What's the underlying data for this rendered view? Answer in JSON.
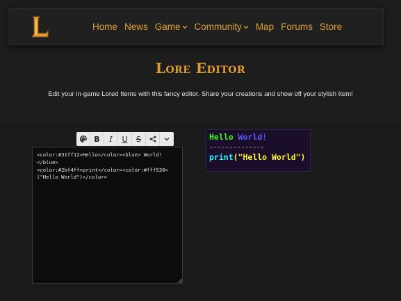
{
  "nav": {
    "items": [
      {
        "label": "Home"
      },
      {
        "label": "News"
      },
      {
        "label": "Game"
      },
      {
        "label": "Community"
      },
      {
        "label": "Map"
      },
      {
        "label": "Forums"
      },
      {
        "label": "Store"
      }
    ],
    "logo_letter": "L"
  },
  "hero": {
    "title": "Lore Editor",
    "subtitle": "Edit your in-game Lored Items with this fancy editor. Share your creations and show off your stylish Item!"
  },
  "toolbar": {
    "buttons": [
      {
        "icon": "palette-icon",
        "glyph": "🎨"
      },
      {
        "icon": "bold-icon",
        "glyph": "B"
      },
      {
        "icon": "italic-icon",
        "glyph": "I"
      },
      {
        "icon": "underline-icon",
        "glyph": "U"
      },
      {
        "icon": "strikethrough-icon",
        "glyph": "S"
      },
      {
        "icon": "share-icon",
        "glyph": "⟨"
      },
      {
        "icon": "chevron-down-icon",
        "glyph": "⌄"
      }
    ]
  },
  "editor": {
    "value": "<color:#31ff12>Hello</color><blue> World!\n</blue>\n<color:#2bf4ff>print</color><color:#fff530>\n(\"Hello World\")</color>"
  },
  "preview": {
    "hello": "Hello",
    "world": " World!",
    "dashes": "--------------",
    "print": "print",
    "args": "(\"Hello World\")",
    "colors": {
      "hello": "#31ff12",
      "world": "#5b5bff",
      "print": "#2bf4ff",
      "args": "#fff530"
    }
  },
  "colors": {
    "accent": "#e39a2e",
    "background": "#1d1d1d"
  }
}
